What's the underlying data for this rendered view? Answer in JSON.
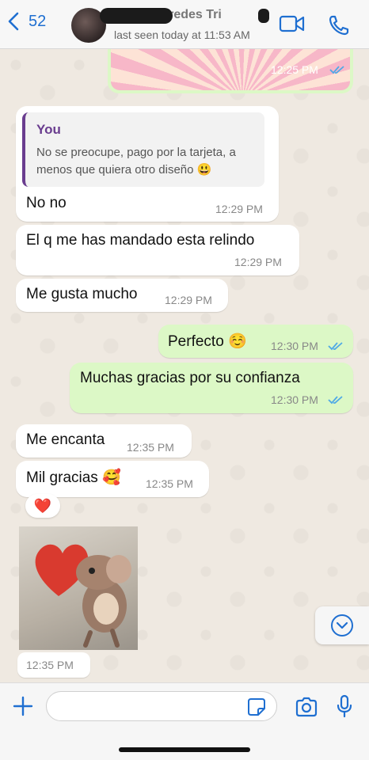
{
  "header": {
    "back_count": "52",
    "contact_name": "hanna Paredes Tri",
    "last_seen": "last seen today at 11:53 AM"
  },
  "messages": {
    "m0_time": "12:25 PM",
    "quote_author": "You",
    "quote_text": "No se preocupe, pago por la tarjeta, a menos que quiera otro diseño 😃",
    "m1_text": "No no",
    "m1_time": "12:29 PM",
    "m2_text": "El q me has mandado esta relindo",
    "m2_time": "12:29 PM",
    "m3_text": "Me gusta mucho",
    "m3_time": "12:29 PM",
    "m4_text": "Perfecto ☺️",
    "m4_time": "12:30 PM",
    "m5_text": "Muchas gracias por su confianza",
    "m5_time": "12:30 PM",
    "m6_text": "Me encanta",
    "m6_time": "12:35 PM",
    "m7_text": "Mil gracias 🥰",
    "m7_time": "12:35 PM",
    "reaction": "❤️",
    "sticker_time": "12:35 PM"
  },
  "input": {
    "placeholder": ""
  },
  "colors": {
    "accent_blue": "#1f6fd1",
    "outgoing_bubble": "#dcf8c6",
    "incoming_bubble": "#ffffff",
    "read_ticks": "#4fa9e6",
    "quote_author": "#6a3d8f"
  },
  "icons": [
    "chevron-left-icon",
    "video-call-icon",
    "phone-icon",
    "double-check-icon",
    "chevron-down-icon",
    "plus-icon",
    "sticker-icon",
    "camera-icon",
    "microphone-icon"
  ]
}
